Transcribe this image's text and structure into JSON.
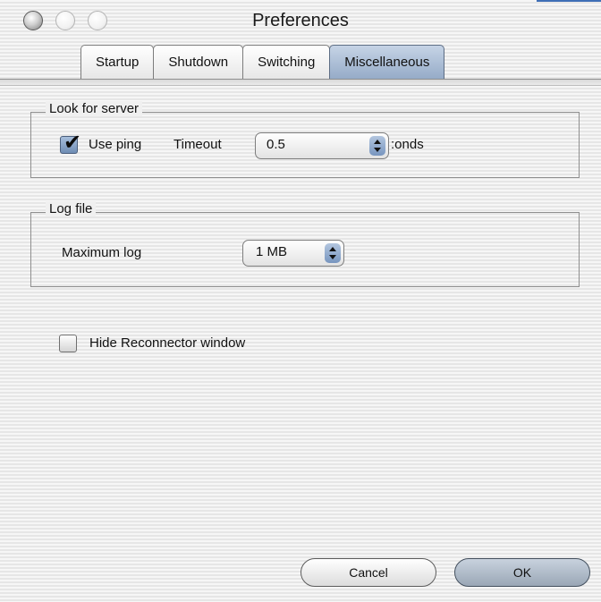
{
  "window": {
    "title": "Preferences"
  },
  "tabs": [
    {
      "label": "Startup",
      "active": false
    },
    {
      "label": "Shutdown",
      "active": false
    },
    {
      "label": "Switching",
      "active": false
    },
    {
      "label": "Miscellaneous",
      "active": true
    }
  ],
  "look_for_server": {
    "title": "Look for server",
    "use_ping_label": "Use ping",
    "use_ping_checked": true,
    "timeout_label": "Timeout",
    "timeout_value": "0.5",
    "timeout_unit": ":onds"
  },
  "log_file": {
    "title": "Log file",
    "max_label": "Maximum log",
    "max_value": "1 MB"
  },
  "hide_reconnector": {
    "label": "Hide Reconnector window",
    "checked": false
  },
  "buttons": {
    "cancel": "Cancel",
    "ok": "OK"
  },
  "colors": {
    "active_tab": "#9cb2cf",
    "popup_arrows": "#7795bf",
    "window_stripe_light": "#f6f6f6",
    "window_stripe_dark": "#e6e6e6"
  },
  "icons": [
    "window-close-icon",
    "window-minimize-icon",
    "window-zoom-icon",
    "checkmark-icon",
    "popup-arrows-icon"
  ]
}
